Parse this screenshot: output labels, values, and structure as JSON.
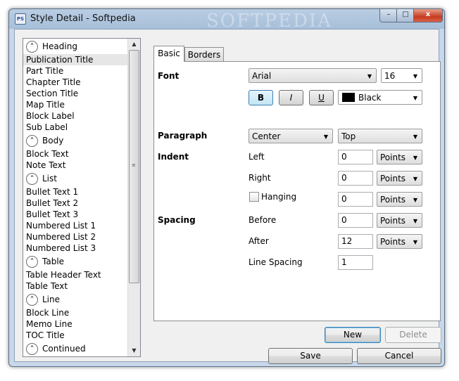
{
  "window": {
    "title": "Style Detail - Softpedia",
    "icon": "document-icon",
    "watermark": "SOFTPEDIA"
  },
  "list": {
    "groups": [
      {
        "label": "Heading",
        "items": [
          "Publication Title",
          "Part Title",
          "Chapter Title",
          "Section Title",
          "Map Title",
          "Block Label",
          "Sub Label"
        ]
      },
      {
        "label": "Body",
        "items": [
          "Block Text",
          "Note Text"
        ]
      },
      {
        "label": "List",
        "items": [
          "Bullet Text 1",
          "Bullet Text 2",
          "Bullet Text 3",
          "Numbered List 1",
          "Numbered List 2",
          "Numbered List 3"
        ]
      },
      {
        "label": "Table",
        "items": [
          "Table Header Text",
          "Table Text"
        ]
      },
      {
        "label": "Line",
        "items": [
          "Block Line",
          "Memo Line",
          "TOC Title"
        ]
      },
      {
        "label": "Continued",
        "items": []
      }
    ],
    "selected": "Publication Title"
  },
  "tabs": [
    "Basic",
    "Borders"
  ],
  "font": {
    "section": "Font",
    "family": "Arial",
    "size": "16",
    "bold": "B",
    "italic": "I",
    "underline": "U",
    "color": "Black",
    "color_hex": "#000000"
  },
  "paragraph": {
    "section": "Paragraph",
    "align": "Center",
    "valign": "Top"
  },
  "indent": {
    "section": "Indent",
    "left_label": "Left",
    "left": "0",
    "right_label": "Right",
    "right": "0",
    "hanging_label": "Hanging",
    "hanging": "0",
    "unit": "Points"
  },
  "spacing": {
    "section": "Spacing",
    "before_label": "Before",
    "before": "0",
    "after_label": "After",
    "after": "12",
    "line_label": "Line Spacing",
    "line": "1",
    "unit": "Points"
  },
  "buttons": {
    "new": "New",
    "delete": "Delete",
    "save": "Save",
    "cancel": "Cancel"
  },
  "titlebar": {
    "minimize": "–",
    "maximize": "□",
    "close": "x"
  }
}
